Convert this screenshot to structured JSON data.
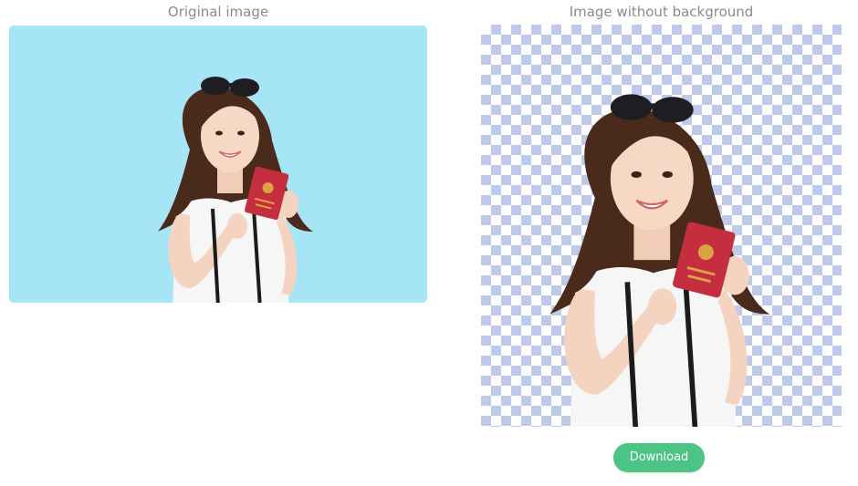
{
  "captions": {
    "original": "Original image",
    "result": "Image without background"
  },
  "actions": {
    "download_label": "Download"
  },
  "colors": {
    "original_background": "#a5e5f5",
    "checker_light": "#ffffff",
    "checker_dark": "#bfc9ea",
    "download_button": "#4cc486"
  },
  "passport": {
    "line1": "日本国",
    "line2": "旅券",
    "line3": "JAPAN",
    "line4": "PASSPORT"
  }
}
